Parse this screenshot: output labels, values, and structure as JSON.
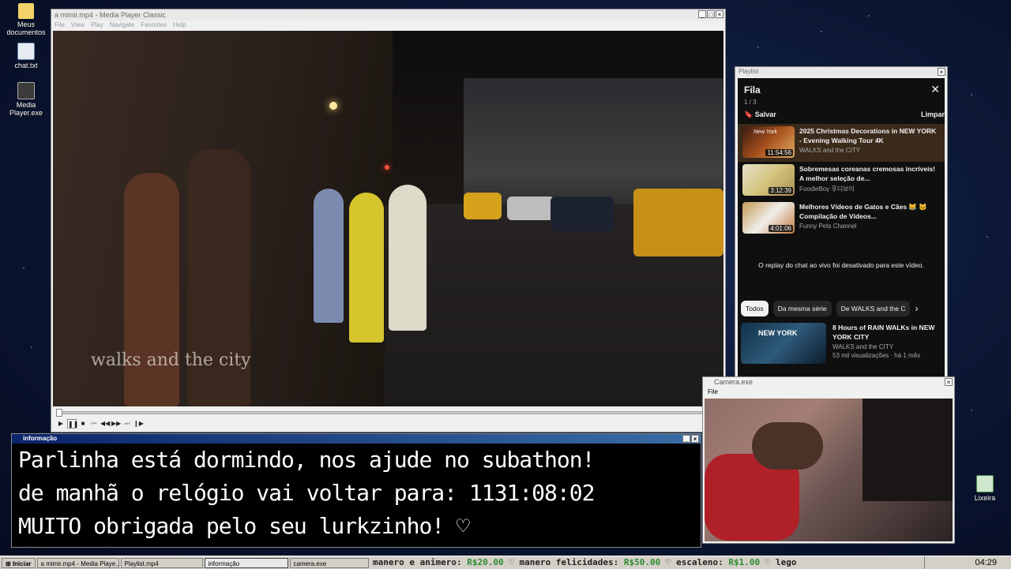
{
  "desktop": {
    "icons": [
      {
        "label": "Meus documentos"
      },
      {
        "label": "chat.txt"
      },
      {
        "label": "Media Player.exe"
      },
      {
        "label": "Lixeira"
      }
    ]
  },
  "player": {
    "title": "a mimir.mp4 - Media Player Classic",
    "menu": [
      "File",
      "View",
      "Play",
      "Navigate",
      "Favorites",
      "Help"
    ],
    "watermark": "walks and the city",
    "progress": 0.01
  },
  "playlist_window": {
    "title": "Playlist",
    "heading": "Fila",
    "count": "1 / 3",
    "save_label": "Salvar",
    "clear_label": "Limpar",
    "items": [
      {
        "title": "2025 Christmas Decorations in NEW YORK - Evening Walking Tour 4K",
        "channel": "WALKS and the CITY",
        "duration": "11:54:56",
        "thumb_text": "New York"
      },
      {
        "title": "Sobremesas coreanas cremosas incríveis! A melhor seleção de...",
        "channel": "FoodieBoy 푸디보이",
        "duration": "3:12:39"
      },
      {
        "title": "Melhores Vídeos de Gatos e Cães 😹 🐱 Compilação de Vídeos...",
        "channel": "Funny Pets Channel",
        "duration": "4:01:06"
      }
    ],
    "chat_disabled": "O replay do chat ao vivo foi desativado para este vídeo.",
    "chips": [
      "Todos",
      "Da mesma série",
      "De WALKS and the C"
    ],
    "recommended": {
      "title": "8 Hours of RAIN WALKs in NEW YORK CITY",
      "channel": "WALKS and the CITY",
      "meta": "53 mil visualizações · há 1 mês",
      "thumb_text": "NEW YORK"
    }
  },
  "info_window": {
    "title": "informação",
    "lines": [
      "Parlinha está dormindo, nos ajude no subathon!",
      "de manhã o relógio vai voltar para:  1131:08:02",
      "MUITO obrigada pelo seu lurkzinho! ♡"
    ]
  },
  "camera_window": {
    "title": "Camera.exe",
    "menu": "File"
  },
  "taskbar": {
    "start": "Iniciar",
    "tasks": [
      "a mimir.mp4 - Media Playe...",
      "Playlist.mp4",
      "informação",
      "camera.exe"
    ],
    "ticker": [
      {
        "name": "manero e animero:",
        "amount": "R$20.00"
      },
      {
        "name": "manero felicidades:",
        "amount": "R$50.00"
      },
      {
        "name": "escaleno:",
        "amount": "R$1.00"
      },
      {
        "name": "lego",
        "amount": ""
      }
    ],
    "clock": "04:29"
  }
}
